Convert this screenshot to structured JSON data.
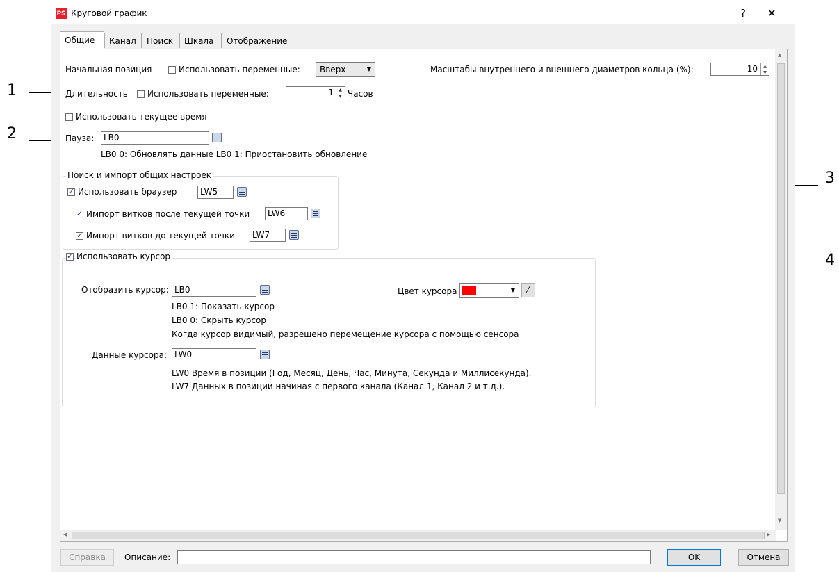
{
  "callouts": [
    "1",
    "2",
    "3",
    "4"
  ],
  "window": {
    "title": "Круговой график",
    "help_glyph": "?",
    "close_glyph": "✕",
    "logo_text": "PS"
  },
  "tabs": [
    {
      "label": "Общие",
      "active": true
    },
    {
      "label": "Канал",
      "active": false
    },
    {
      "label": "Поиск",
      "active": false
    },
    {
      "label": "Шкала",
      "active": false
    },
    {
      "label": "Отображение",
      "active": false
    }
  ],
  "general": {
    "start_position_label": "Начальная позиция",
    "use_vars_label": "Использовать переменные:",
    "direction_value": "Вверх",
    "ring_scale_label": "Масштабы внутреннего и внешнего диаметров кольца (%):",
    "ring_scale_value": "10",
    "duration_label": "Длительность",
    "duration_use_vars_label": "Использовать переменные:",
    "duration_value": "1",
    "duration_unit": "Часов",
    "use_current_time_label": "Использовать текущее время",
    "pause_label": "Пауза:",
    "pause_value": "LB0",
    "pause_hint": "LB0 0: Обновлять данные LB0 1: Приостановить обновление"
  },
  "search_import": {
    "title": "Поиск и импорт общих настроек",
    "use_browser_label": "Использовать браузер",
    "use_browser_value": "LW5",
    "import_after_label": "Импорт витков после текущей точки",
    "import_after_value": "LW6",
    "import_before_label": "Импорт витков до текущей точки",
    "import_before_value": "LW7"
  },
  "cursor": {
    "use_cursor_label": "Использовать курсор",
    "show_cursor_label": "Отобразить курсор:",
    "show_cursor_value": "LB0",
    "hint_1": "LB0 1: Показать курсор",
    "hint_2": "LB0 0: Скрыть курсор",
    "hint_3": "Когда курсор видимый, разрешено перемещение курсора с помощью сенсора",
    "color_label": "Цвет курсора",
    "color_value": "#ff0000",
    "data_label": "Данные курсора:",
    "data_value": "LW0",
    "data_hint_1": "LW0 Время в позиции (Год, Месяц, День, Час, Минута, Секунда и Миллисекунда).",
    "data_hint_2": "LW7 Данных в позиции начиная с первого канала (Канал 1, Канал 2 и т.д.)."
  },
  "footer": {
    "help_label": "Справка",
    "description_label": "Описание:",
    "description_value": "",
    "ok_label": "OK",
    "cancel_label": "Отмена"
  }
}
